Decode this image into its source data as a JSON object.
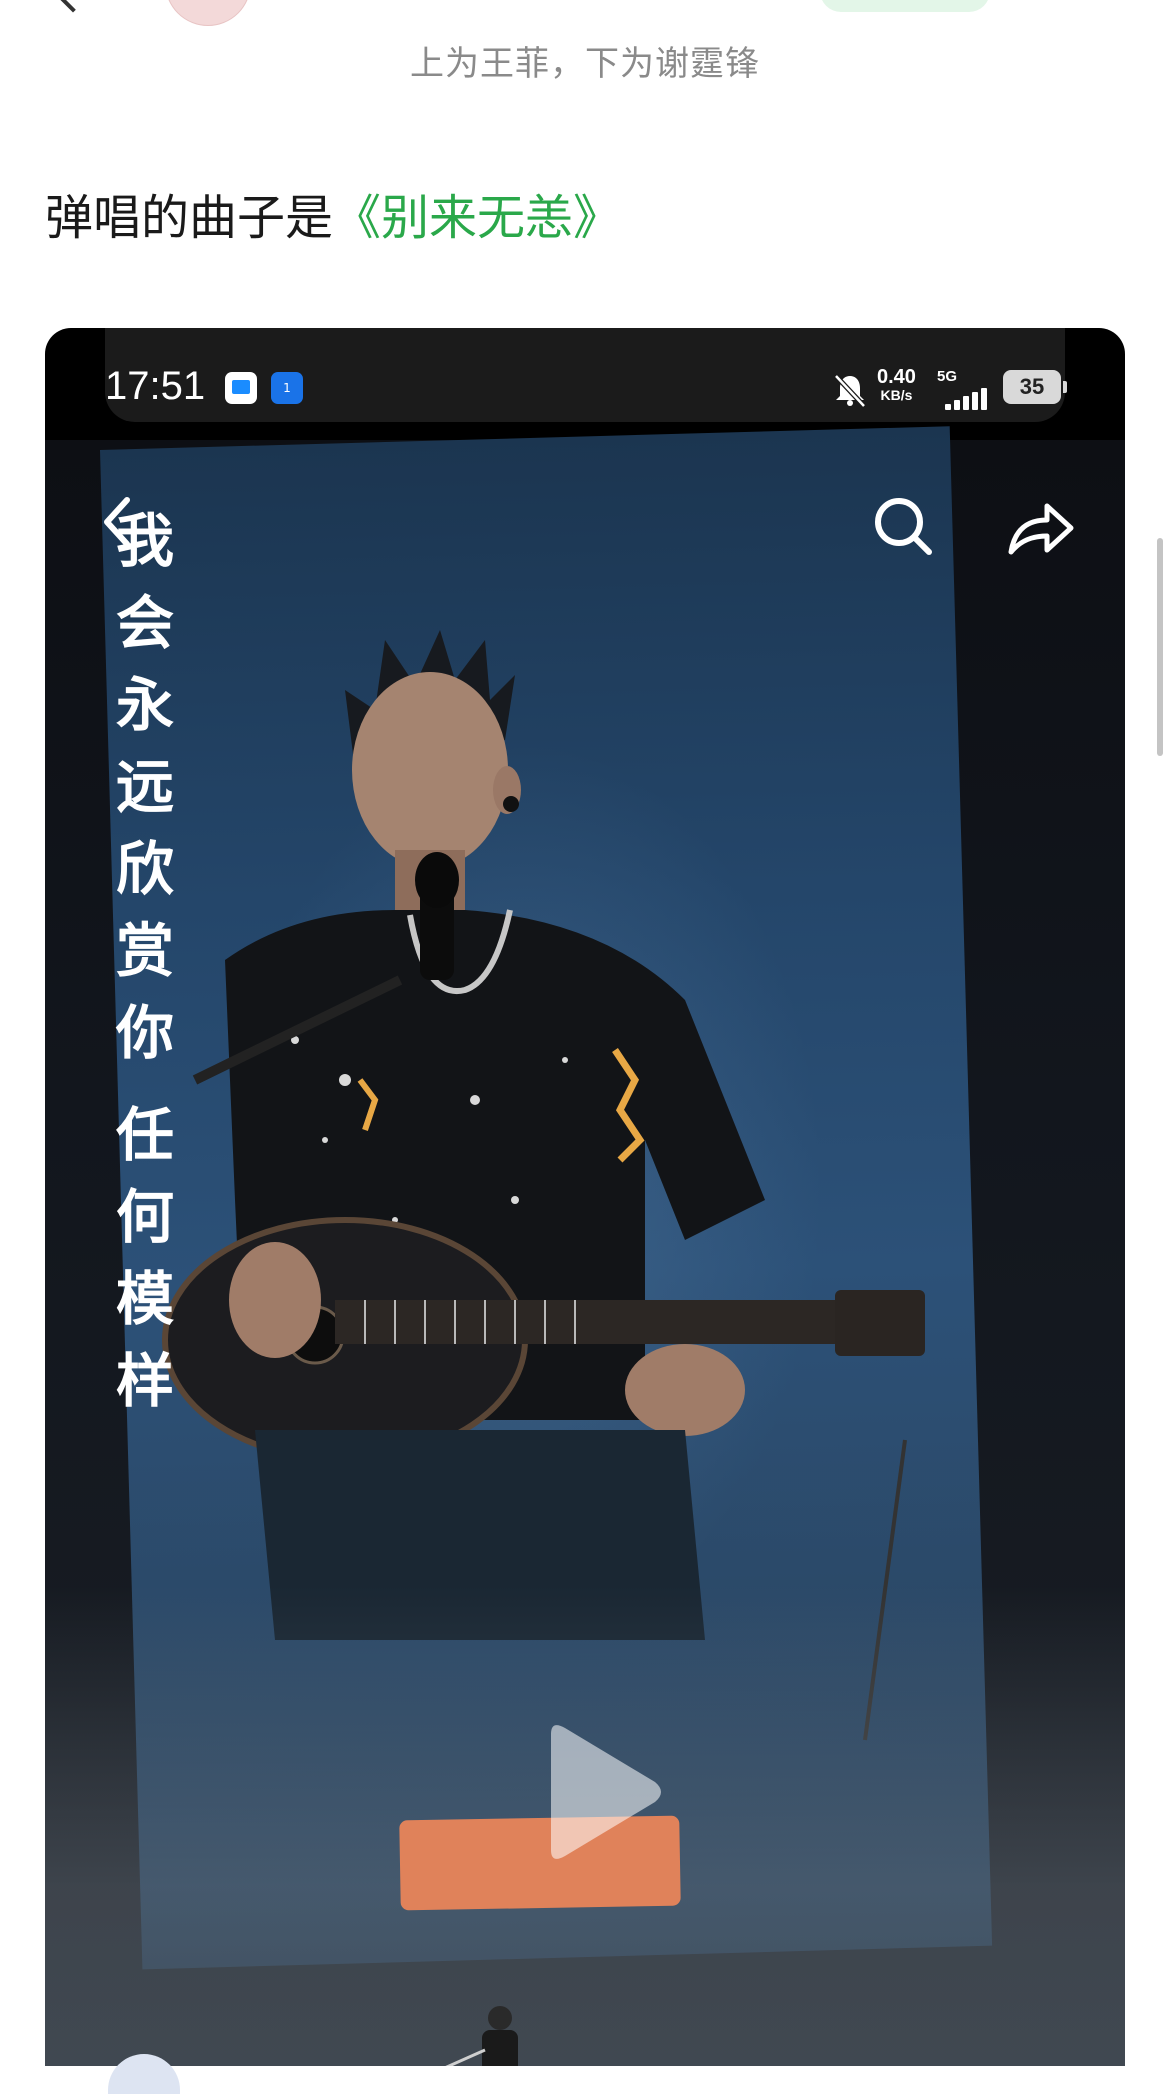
{
  "caption": {
    "text": "上为王菲，下为谢霆锋"
  },
  "post": {
    "line_prefix": "弹唱的曲子是",
    "song_title": "《别来无恙》"
  },
  "embedded_screenshot": {
    "status_bar": {
      "time": "17:51",
      "app_badge": "1",
      "net_speed_value": "0.40",
      "net_speed_unit": "KB/s",
      "network_type": "5G",
      "battery": "35"
    },
    "video": {
      "lyrics_line1": [
        "我",
        "会",
        "永",
        "远",
        "欣",
        "赏",
        "你"
      ],
      "lyrics_line2": [
        "任",
        "何",
        "模",
        "样"
      ],
      "icons": [
        "back-icon",
        "search-icon",
        "share-icon",
        "play-icon"
      ]
    }
  },
  "colors": {
    "accent_green": "#2aa84a",
    "caption_gray": "#8a8a8a",
    "text_dark": "#1a1a1a"
  }
}
